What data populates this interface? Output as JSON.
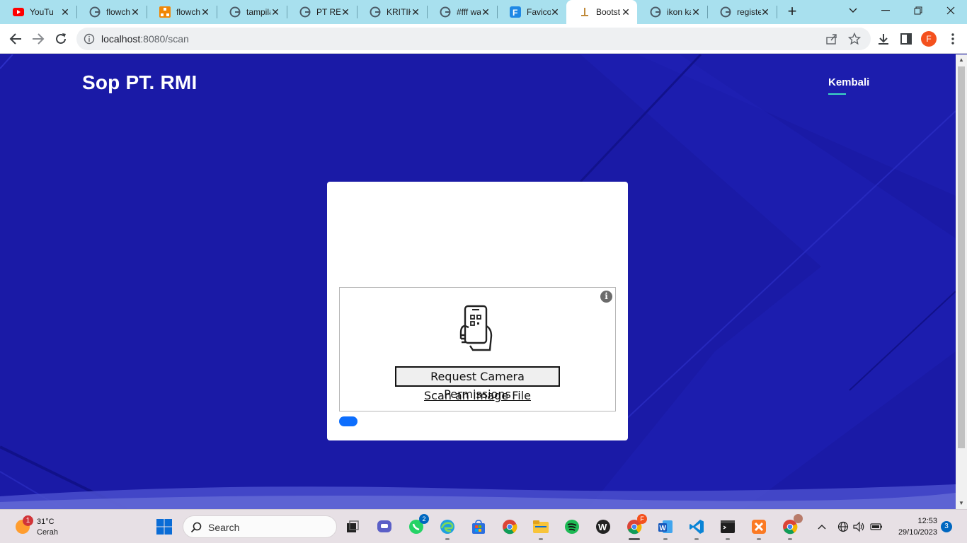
{
  "browser": {
    "tabs": [
      {
        "title": "YouTube",
        "icon": "youtube-icon",
        "active": false
      },
      {
        "title": "flowchart",
        "icon": "google-icon",
        "active": false
      },
      {
        "title": "flowchart",
        "icon": "drawio-icon",
        "active": false
      },
      {
        "title": "tampilan",
        "icon": "google-icon",
        "active": false
      },
      {
        "title": "PT REKAYASA",
        "icon": "google-icon",
        "active": false
      },
      {
        "title": "KRITIK",
        "icon": "google-icon",
        "active": false
      },
      {
        "title": "#fff warna",
        "icon": "google-icon",
        "active": false
      },
      {
        "title": "Favicon",
        "icon": "favicon-io-icon",
        "active": false
      },
      {
        "title": "Bootstrap",
        "icon": "bootstrap-icon",
        "active": true
      },
      {
        "title": "ikon kamera",
        "icon": "google-icon",
        "active": false
      },
      {
        "title": "register",
        "icon": "google-icon",
        "active": false
      }
    ],
    "url_host": "localhost",
    "url_path": ":8080/scan",
    "profile_initial": "F"
  },
  "page": {
    "brand": "Sop PT. RMI",
    "nav_back": "Kembali",
    "scanner": {
      "request_button": "Request Camera Permissions",
      "scan_file_link": "Scan an Image File",
      "info_glyph": "i"
    }
  },
  "taskbar": {
    "weather_temp": "31°C",
    "weather_condition": "Cerah",
    "weather_badge": "1",
    "search_placeholder": "Search",
    "whatsapp_badge": "2",
    "chrome_badge": "F",
    "clock_time": "12:53",
    "clock_date": "29/10/2023",
    "notification_count": "3"
  },
  "colors": {
    "page_background": "#1a1aa6",
    "accent_underline": "#3ddbc4",
    "pill": "#0d6efd",
    "tab_strip": "#a8e0ee"
  }
}
